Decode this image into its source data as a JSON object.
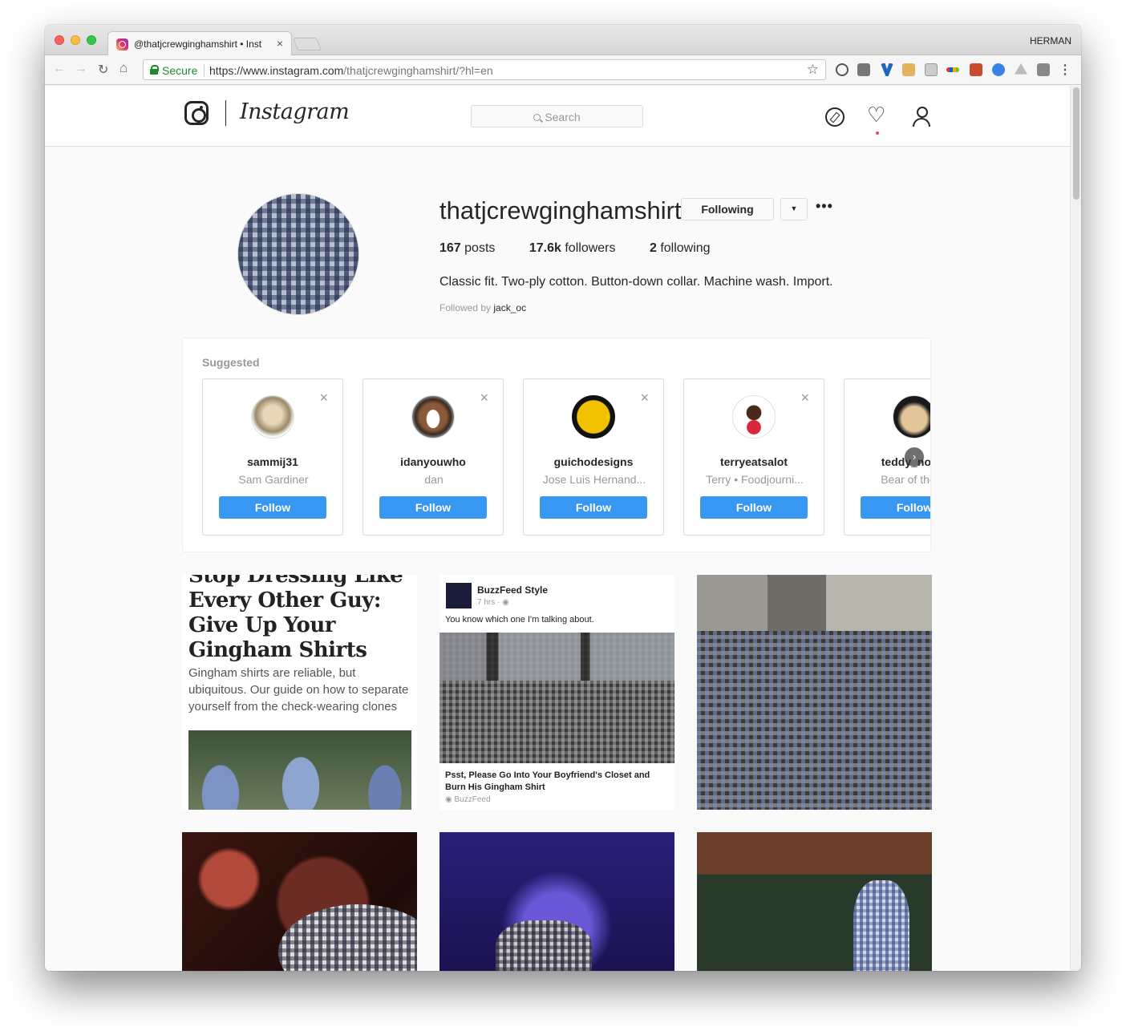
{
  "browser": {
    "tab_title": "@thatjcrewginghamshirt • Inst",
    "tab_close": "×",
    "profile_name": "HERMAN",
    "secure_label": "Secure",
    "url_scheme_host": "https://www.instagram.com",
    "url_path": "/thatjcrewginghamshirt/?hl=en"
  },
  "instagram": {
    "wordmark": "Instagram",
    "search_placeholder": "Search"
  },
  "profile": {
    "username": "thatjcrewginghamshirt",
    "following_button": "Following",
    "dropdown_glyph": "▼",
    "more_glyph": "•••",
    "posts_count": "167",
    "posts_label": "posts",
    "followers_count": "17.6k",
    "followers_label": "followers",
    "following_count": "2",
    "following_label": "following",
    "bio": "Classic fit. Two-ply cotton. Button-down collar. Machine wash. Import.",
    "followed_by_label": "Followed by",
    "followed_by_user": "jack_oc"
  },
  "suggested": {
    "title": "Suggested",
    "close_glyph": "×",
    "next_glyph": "›",
    "cards": [
      {
        "username": "sammij31",
        "name": "Sam Gardiner",
        "button": "Follow"
      },
      {
        "username": "idanyouwho",
        "name": "dan",
        "button": "Follow"
      },
      {
        "username": "guichodesigns",
        "name": "Jose Luis Hernand...",
        "button": "Follow"
      },
      {
        "username": "terryeatsalot",
        "name": "Terry • Foodjourni...",
        "button": "Follow"
      },
      {
        "username": "teddy_not_a",
        "name": "Bear of the Cl",
        "button": "Follow"
      }
    ]
  },
  "posts": {
    "article": {
      "headline": "Stop Dressing Like Every Other Guy: Give Up Your Gingham Shirts",
      "body": "Gingham shirts are reliable, but ubiquitous. Our guide on how to separate yourself from the check-wearing clones"
    },
    "facebook": {
      "page": "BuzzFeed Style",
      "time": "7 hrs · ◉",
      "caption": "You know which one I'm talking about.",
      "headline": "Psst, Please Go Into Your Boyfriend's Closet and Burn His Gingham Shirt",
      "source": "◉ BuzzFeed"
    }
  }
}
